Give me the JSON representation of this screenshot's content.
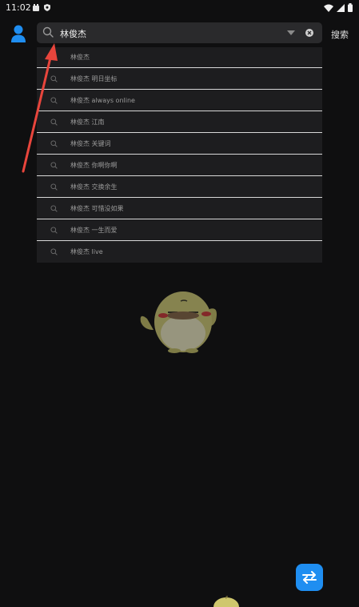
{
  "status_bar": {
    "time": "11:02"
  },
  "search": {
    "query": "林俊杰",
    "action_label": "搜索"
  },
  "suggestions": [
    "林俊杰",
    "林俊杰 明日坐标",
    "林俊杰 always online",
    "林俊杰 江南",
    "林俊杰 关键词",
    "林俊杰 你啊你啊",
    "林俊杰 交换余生",
    "林俊杰 可惜没如果",
    "林俊杰 一生而爱",
    "林俊杰 live"
  ],
  "icons": {
    "profile": "user-icon",
    "search": "search-icon",
    "dropdown": "dropdown-icon",
    "clear": "clear-icon",
    "swap": "swap-icon"
  },
  "colors": {
    "background": "#0f0f10",
    "search_box": "#2a2a2c",
    "suggestion_panel": "#1d1d1f",
    "accent_blue": "#1f8ef1",
    "annotation_red": "#e8453c"
  }
}
